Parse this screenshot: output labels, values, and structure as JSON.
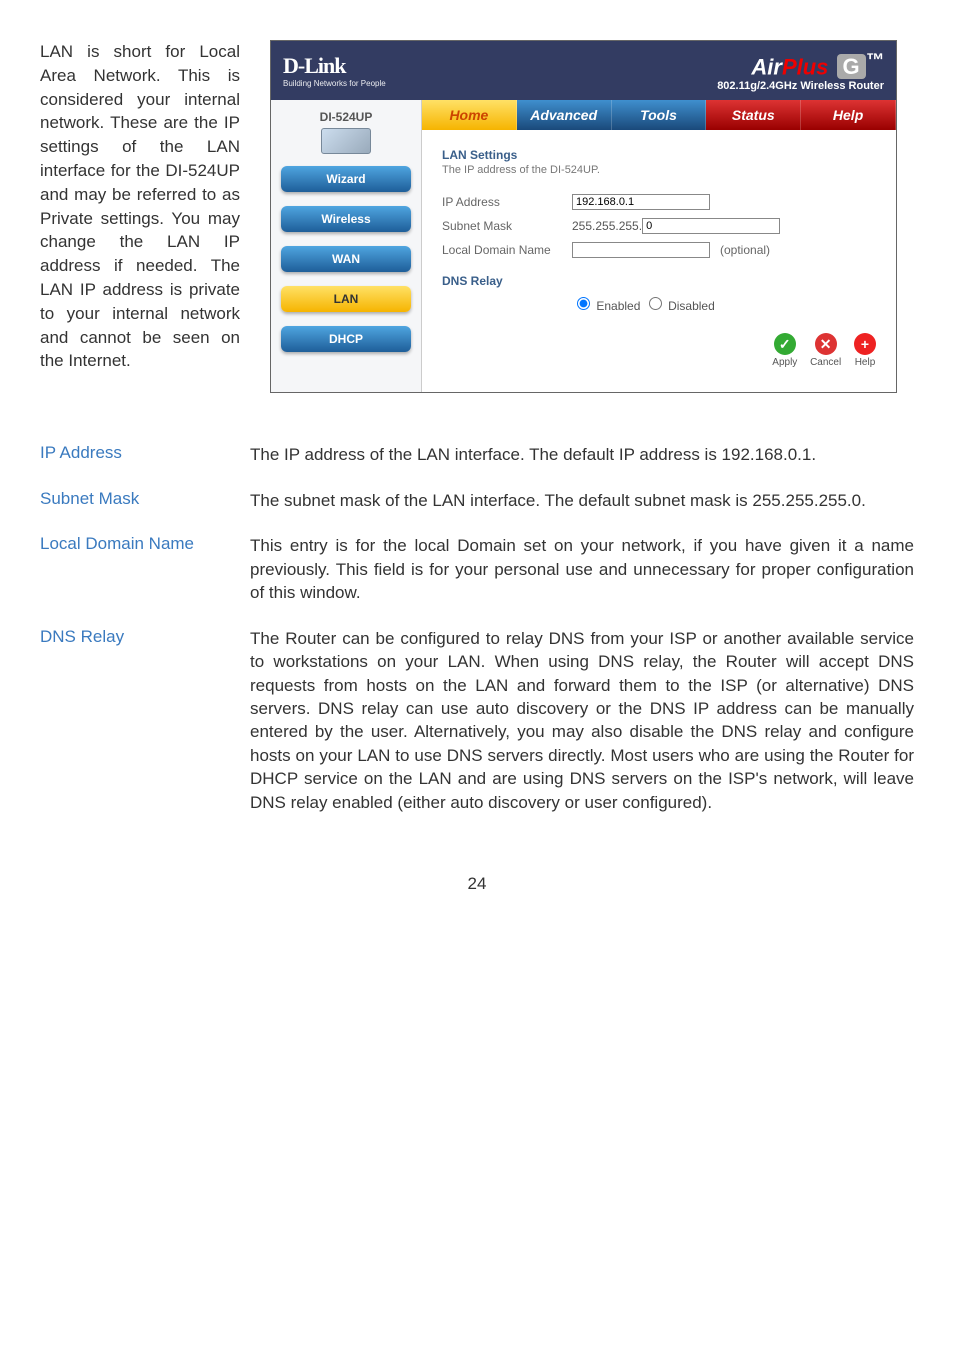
{
  "intro_text": "LAN is short for Local Area Network. This is considered your internal network. These are the IP settings of the LAN interface for the DI-524UP and may be referred to as Private settings. You may change the LAN IP address if needed. The LAN IP address is private to your internal network and cannot be seen on the Internet.",
  "router": {
    "brand": {
      "logo": "D-Link",
      "tagline": "Building Networks for People"
    },
    "product": {
      "logo_air": "Air",
      "logo_plus": "Plus",
      "logo_g": "G",
      "trademark": "™",
      "subtitle": "802.11g/2.4GHz Wireless Router"
    },
    "model": "DI-524UP",
    "nav": {
      "wizard": "Wizard",
      "wireless": "Wireless",
      "wan": "WAN",
      "lan": "LAN",
      "dhcp": "DHCP"
    },
    "tabs": {
      "home": "Home",
      "advanced": "Advanced",
      "tools": "Tools",
      "status": "Status",
      "help": "Help"
    },
    "panel": {
      "heading": "LAN Settings",
      "subtitle": "The IP address of the DI-524UP.",
      "ip_label": "IP Address",
      "ip_value": "192.168.0.1",
      "subnet_label": "Subnet Mask",
      "subnet_prefix": "255.255.255.",
      "subnet_oct": "0",
      "ldn_label": "Local Domain Name",
      "ldn_value": "",
      "ldn_hint": "(optional)",
      "dns_heading": "DNS Relay",
      "dns_enabled": "Enabled",
      "dns_disabled": "Disabled"
    },
    "actions": {
      "apply": "Apply",
      "cancel": "Cancel",
      "help": "Help"
    }
  },
  "definitions": {
    "ip_address": {
      "term": "IP Address",
      "body": "The IP address of the LAN interface. The default IP address is 192.168.0.1."
    },
    "subnet_mask": {
      "term": "Subnet Mask",
      "body": "The subnet mask of the LAN interface. The default subnet mask is 255.255.255.0."
    },
    "local_domain": {
      "term": "Local Domain Name",
      "body": "This entry is for the local Domain set on your network, if you have given it a name previously. This field is for your personal use and unnecessary for proper configuration of this window."
    },
    "dns_relay": {
      "term": "DNS Relay",
      "body": "The Router can be configured to relay DNS from your ISP or another available service to workstations on your LAN. When using DNS relay, the Router will accept DNS requests from hosts on the LAN and forward them to the ISP (or alternative) DNS servers. DNS relay can use auto discovery or the DNS IP address can be manually entered by the user. Alternatively, you may also disable the DNS relay and configure hosts on your LAN to use DNS servers directly. Most users who are using the Router for DHCP service on the LAN and are using DNS servers on the ISP's network, will leave DNS relay enabled (either auto discovery or user configured)."
    }
  },
  "page_number": "24"
}
